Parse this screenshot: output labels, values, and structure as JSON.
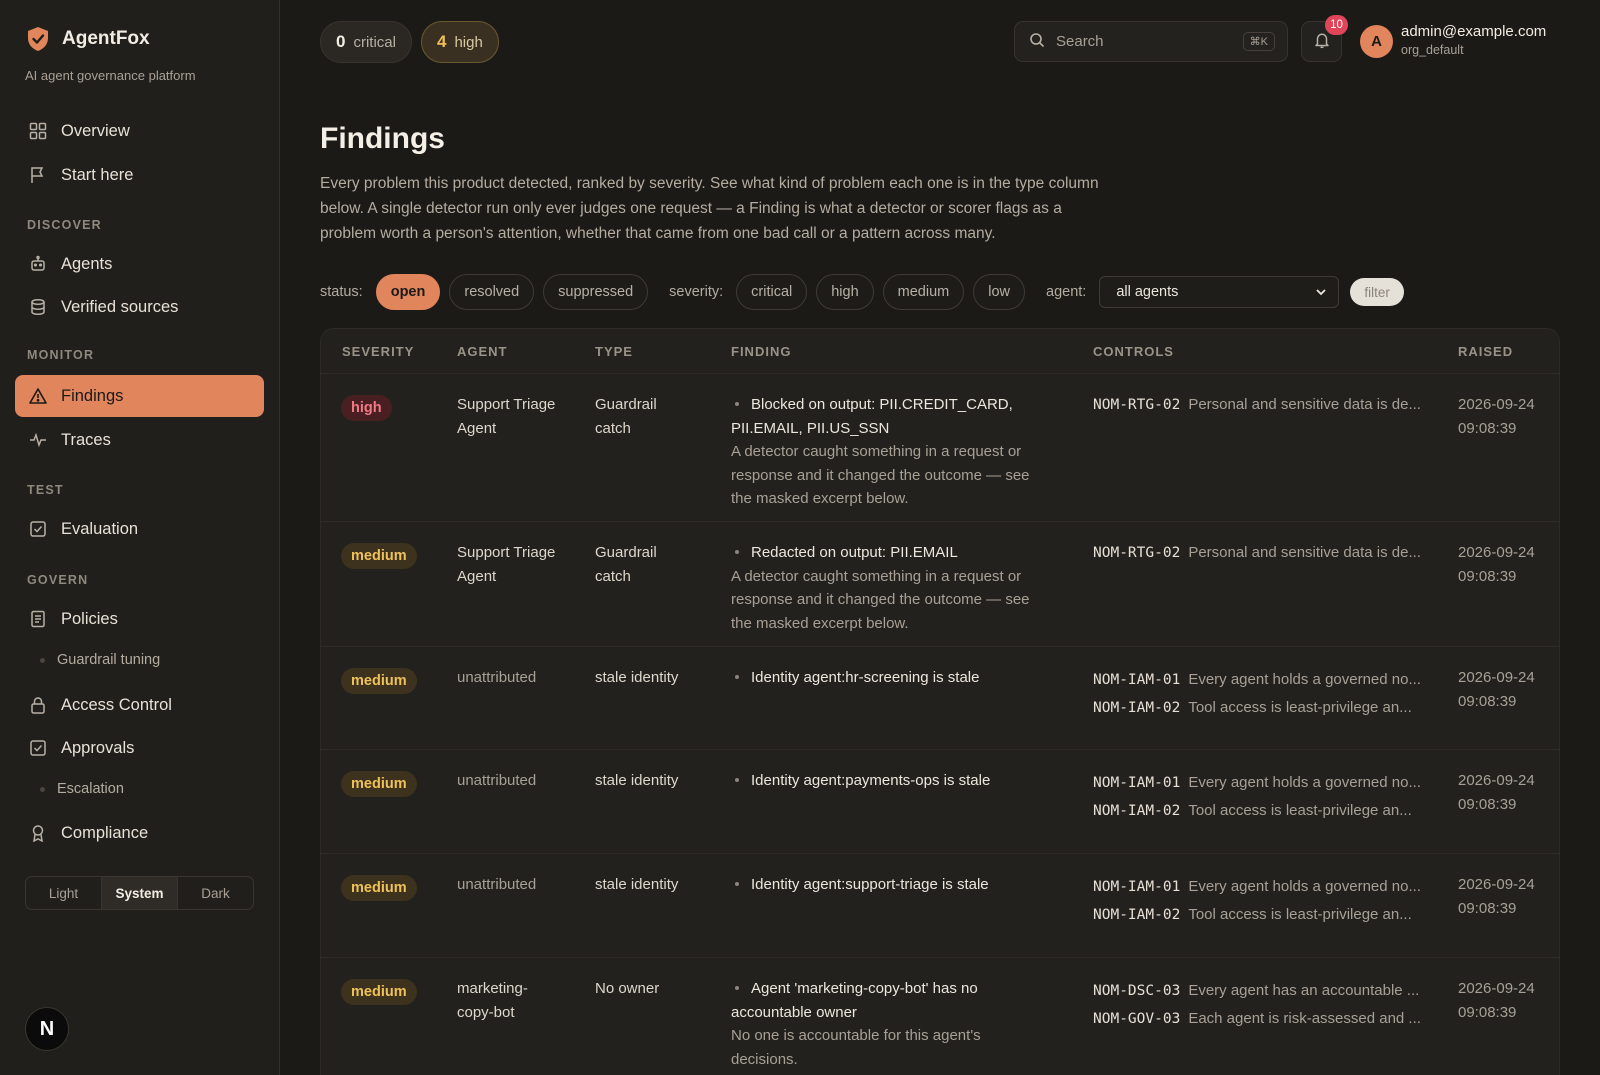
{
  "brand": {
    "name": "AgentFox",
    "tagline": "AI agent governance platform"
  },
  "nav": {
    "overview": "Overview",
    "start_here": "Start here",
    "section_discover": "DISCOVER",
    "agents": "Agents",
    "verified_sources": "Verified sources",
    "section_monitor": "MONITOR",
    "findings": "Findings",
    "traces": "Traces",
    "section_test": "TEST",
    "evaluation": "Evaluation",
    "section_govern": "GOVERN",
    "policies": "Policies",
    "guardrail_tuning": "Guardrail tuning",
    "access_control": "Access Control",
    "approvals": "Approvals",
    "escalation": "Escalation",
    "compliance": "Compliance"
  },
  "theme": {
    "light": "Light",
    "system": "System",
    "dark": "Dark",
    "selected": "System"
  },
  "badge_letter": "N",
  "topbar": {
    "critical_count": "0",
    "critical_label": "critical",
    "high_count": "4",
    "high_label": "high",
    "search_placeholder": "Search",
    "search_shortcut": "⌘K",
    "notifications": "10",
    "avatar_letter": "A",
    "user_email": "admin@example.com",
    "user_org": "org_default"
  },
  "page": {
    "title": "Findings",
    "description": "Every problem this product detected, ranked by severity. See what kind of problem each one is in the type column below. A single detector run only ever judges one request — a Finding is what a detector or scorer flags as a problem worth a person's attention, whether that came from one bad call or a pattern across many."
  },
  "filters": {
    "status_label": "status:",
    "status_open": "open",
    "status_resolved": "resolved",
    "status_suppressed": "suppressed",
    "severity_label": "severity:",
    "sev_critical": "critical",
    "sev_high": "high",
    "sev_medium": "medium",
    "sev_low": "low",
    "agent_label": "agent:",
    "agent_value": "all agents",
    "filter_button": "filter"
  },
  "table": {
    "headers": {
      "severity": "SEVERITY",
      "agent": "AGENT",
      "type": "TYPE",
      "finding": "FINDING",
      "controls": "CONTROLS",
      "raised": "RAISED"
    },
    "rows": [
      {
        "severity": "high",
        "agent": "Support Triage Agent",
        "type": "Guardrail catch",
        "title": "Blocked on output: PII.CREDIT_CARD, PII.EMAIL, PII.US_SSN",
        "desc": "A detector caught something in a request or response and it changed the outcome — see the masked excerpt below.",
        "controls": [
          {
            "code": "NOM-RTG-02",
            "text": "Personal and sensitive data is de..."
          }
        ],
        "raised": "2026-09-24 09:08:39"
      },
      {
        "severity": "medium",
        "agent": "Support Triage Agent",
        "type": "Guardrail catch",
        "title": "Redacted on output: PII.EMAIL",
        "desc": "A detector caught something in a request or response and it changed the outcome — see the masked excerpt below.",
        "controls": [
          {
            "code": "NOM-RTG-02",
            "text": "Personal and sensitive data is de..."
          }
        ],
        "raised": "2026-09-24 09:08:39"
      },
      {
        "severity": "medium",
        "agent": "unattributed",
        "type": "stale identity",
        "title": "Identity agent:hr-screening is stale",
        "desc": "",
        "controls": [
          {
            "code": "NOM-IAM-01",
            "text": "Every agent holds a governed no..."
          },
          {
            "code": "NOM-IAM-02",
            "text": "Tool access is least-privilege an..."
          }
        ],
        "raised": "2026-09-24 09:08:39"
      },
      {
        "severity": "medium",
        "agent": "unattributed",
        "type": "stale identity",
        "title": "Identity agent:payments-ops is stale",
        "desc": "",
        "controls": [
          {
            "code": "NOM-IAM-01",
            "text": "Every agent holds a governed no..."
          },
          {
            "code": "NOM-IAM-02",
            "text": "Tool access is least-privilege an..."
          }
        ],
        "raised": "2026-09-24 09:08:39"
      },
      {
        "severity": "medium",
        "agent": "unattributed",
        "type": "stale identity",
        "title": "Identity agent:support-triage is stale",
        "desc": "",
        "controls": [
          {
            "code": "NOM-IAM-01",
            "text": "Every agent holds a governed no..."
          },
          {
            "code": "NOM-IAM-02",
            "text": "Tool access is least-privilege an..."
          }
        ],
        "raised": "2026-09-24 09:08:39"
      },
      {
        "severity": "medium",
        "agent": "marketing-copy-bot",
        "type": "No owner",
        "title": "Agent 'marketing-copy-bot' has no accountable owner",
        "desc": "No one is accountable for this agent's decisions.",
        "controls": [
          {
            "code": "NOM-DSC-03",
            "text": "Every agent has an accountable ..."
          },
          {
            "code": "NOM-GOV-03",
            "text": "Each agent is risk-assessed and ..."
          }
        ],
        "raised": "2026-09-24 09:08:39"
      }
    ]
  }
}
